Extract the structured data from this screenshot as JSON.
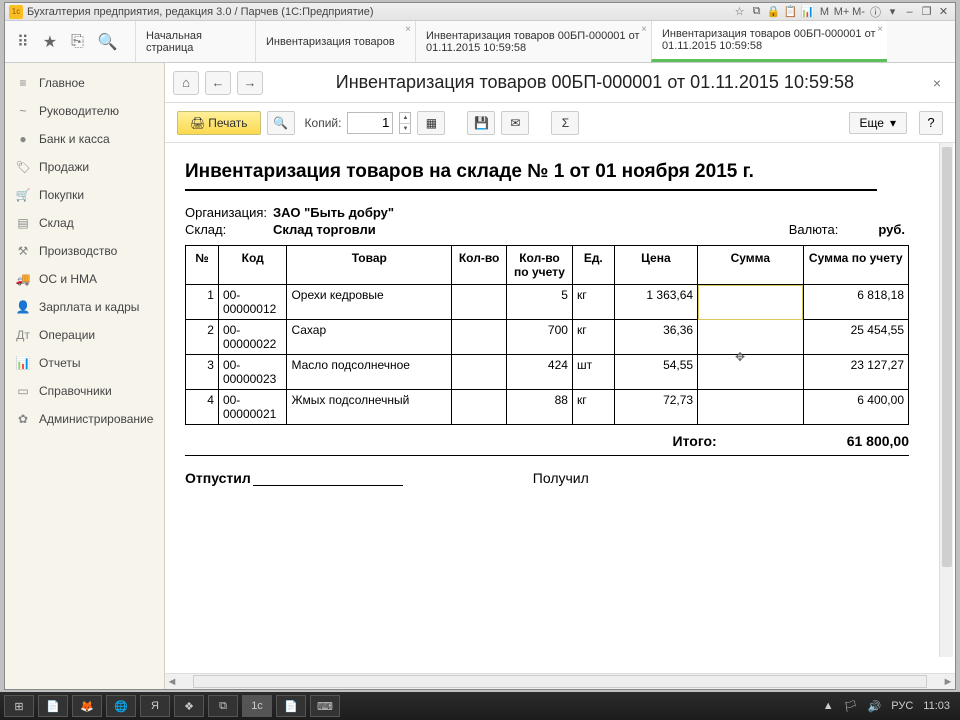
{
  "titlebar": {
    "icon_text": "1c",
    "title": "Бухгалтерия предприятия, редакция 3.0 / Парчев  (1С:Предприятие)",
    "sys_icons": [
      "☆",
      "⧉",
      "🔒",
      "📋",
      "📊",
      "M",
      "M+",
      "M-",
      "ⓘ",
      "▾",
      "–",
      "❐",
      "✕"
    ]
  },
  "tabs": {
    "items": [
      {
        "label": "Начальная страница"
      },
      {
        "label": "Инвентаризация товаров"
      },
      {
        "label": "Инвентаризация товаров 00БП-000001 от",
        "sub": "01.11.2015 10:59:58"
      },
      {
        "label": "Инвентаризация товаров 00БП-000001 от",
        "sub": "01.11.2015 10:59:58"
      }
    ]
  },
  "icons": {
    "grid": "⠿",
    "star": "★",
    "clip": "⎘",
    "search": "🔍"
  },
  "sidebar": [
    {
      "icon": "≡",
      "label": "Главное"
    },
    {
      "icon": "~",
      "label": "Руководителю"
    },
    {
      "icon": "●",
      "label": "Банк и касса"
    },
    {
      "icon": "🏷",
      "label": "Продажи"
    },
    {
      "icon": "🛒",
      "label": "Покупки"
    },
    {
      "icon": "▤",
      "label": "Склад"
    },
    {
      "icon": "⚒",
      "label": "Производство"
    },
    {
      "icon": "🚚",
      "label": "ОС и НМА"
    },
    {
      "icon": "👤",
      "label": "Зарплата и кадры"
    },
    {
      "icon": "Дт",
      "label": "Операции"
    },
    {
      "icon": "📊",
      "label": "Отчеты"
    },
    {
      "icon": "▭",
      "label": "Справочники"
    },
    {
      "icon": "✿",
      "label": "Администрирование"
    }
  ],
  "page": {
    "nav": {
      "home": "⌂",
      "back": "←",
      "fwd": "→"
    },
    "title": "Инвентаризация товаров 00БП-000001 от 01.11.2015 10:59:58",
    "close": "×"
  },
  "toolbar": {
    "print_icon": "🖨",
    "print": "Печать",
    "preview_icon": "🔍",
    "copies_label": "Копий:",
    "copies_value": "1",
    "btn2": "▦",
    "save": "💾",
    "mail": "✉",
    "sum": "Σ",
    "more": "Еще",
    "more_arrow": "▾",
    "help": "?"
  },
  "doc": {
    "title": "Инвентаризация товаров на складе № 1 от 01 ноября 2015 г.",
    "org_label": "Организация:",
    "org_value": "ЗАО \"Быть добру\"",
    "wh_label": "Склад:",
    "wh_value": "Склад торговли",
    "cur_label": "Валюта:",
    "cur_value": "руб.",
    "headers": {
      "no": "№",
      "code": "Код",
      "name": "Товар",
      "qty": "Кол-во",
      "qty_acc": "Кол-во по учету",
      "unit": "Ед.",
      "price": "Цена",
      "sum": "Сумма",
      "sum_acc": "Сумма по учету"
    },
    "rows": [
      {
        "no": "1",
        "code": "00-00000012",
        "name": "Орехи кедровые",
        "qty": "",
        "qty_acc": "5",
        "unit": "кг",
        "price": "1 363,64",
        "sum": "",
        "sum_acc": "6 818,18"
      },
      {
        "no": "2",
        "code": "00-00000022",
        "name": "Сахар",
        "qty": "",
        "qty_acc": "700",
        "unit": "кг",
        "price": "36,36",
        "sum": "",
        "sum_acc": "25 454,55"
      },
      {
        "no": "3",
        "code": "00-00000023",
        "name": "Масло подсолнечное",
        "qty": "",
        "qty_acc": "424",
        "unit": "шт",
        "price": "54,55",
        "sum": "",
        "sum_acc": "23 127,27"
      },
      {
        "no": "4",
        "code": "00-00000021",
        "name": "Жмых подсолнечный",
        "qty": "",
        "qty_acc": "88",
        "unit": "кг",
        "price": "72,73",
        "sum": "",
        "sum_acc": "6 400,00"
      }
    ],
    "total_label": "Итого:",
    "total_value": "61 800,00",
    "released": "Отпустил",
    "received": "Получил"
  },
  "taskbar": {
    "items": [
      "⊞",
      "📄",
      "🦊",
      "🌐",
      "Я",
      "❖",
      "⧉",
      "1c",
      "📄",
      "⌨"
    ],
    "tray_icons": [
      "▲",
      "🏳",
      "🔊",
      "РУС"
    ],
    "time": "11:03"
  }
}
